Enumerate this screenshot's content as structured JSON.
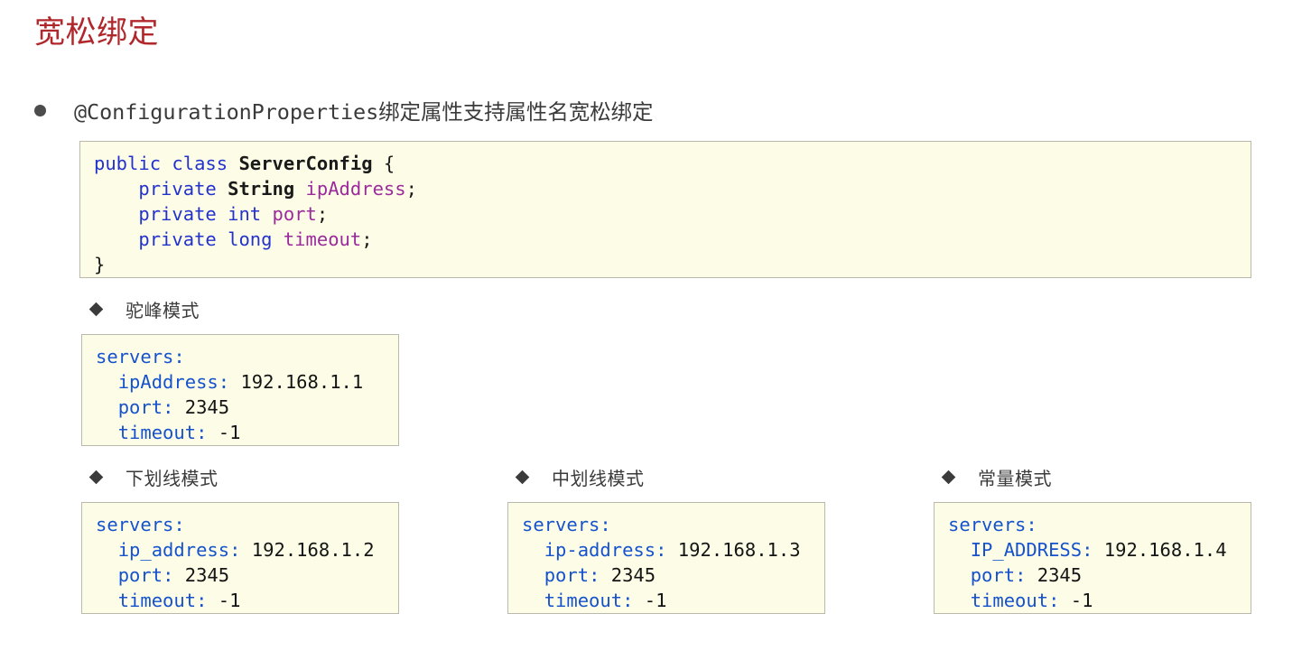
{
  "slide": {
    "title": "宽松绑定",
    "title_color": "#b1282c",
    "background_color": "#ffffff"
  },
  "bullet": {
    "marker": "round-bullet",
    "text": "@ConfigurationProperties绑定属性支持属性名宽松绑定"
  },
  "code_java": {
    "language": "java",
    "background_color": "#fdfde7",
    "border_color": "#b9b9ad",
    "lines": [
      {
        "tokens": [
          {
            "t": "public",
            "c": "kw"
          },
          {
            "t": " ",
            "c": "pun"
          },
          {
            "t": "class",
            "c": "kw"
          },
          {
            "t": " ",
            "c": "pun"
          },
          {
            "t": "ServerConfig",
            "c": "typ"
          },
          {
            "t": " {",
            "c": "pun"
          }
        ]
      },
      {
        "tokens": [
          {
            "t": "    ",
            "c": "pun"
          },
          {
            "t": "private",
            "c": "kw"
          },
          {
            "t": " ",
            "c": "pun"
          },
          {
            "t": "String",
            "c": "typ"
          },
          {
            "t": " ",
            "c": "pun"
          },
          {
            "t": "ipAddress",
            "c": "fld"
          },
          {
            "t": ";",
            "c": "pun"
          }
        ]
      },
      {
        "tokens": [
          {
            "t": "    ",
            "c": "pun"
          },
          {
            "t": "private",
            "c": "kw"
          },
          {
            "t": " ",
            "c": "pun"
          },
          {
            "t": "int",
            "c": "kw"
          },
          {
            "t": " ",
            "c": "pun"
          },
          {
            "t": "port",
            "c": "fld"
          },
          {
            "t": ";",
            "c": "pun"
          }
        ]
      },
      {
        "tokens": [
          {
            "t": "    ",
            "c": "pun"
          },
          {
            "t": "private",
            "c": "kw"
          },
          {
            "t": " ",
            "c": "pun"
          },
          {
            "t": "long",
            "c": "kw"
          },
          {
            "t": " ",
            "c": "pun"
          },
          {
            "t": "timeout",
            "c": "fld"
          },
          {
            "t": ";",
            "c": "pun"
          }
        ]
      },
      {
        "tokens": [
          {
            "t": "}",
            "c": "pun"
          }
        ]
      }
    ]
  },
  "sections": [
    {
      "id": "camel",
      "marker": "diamond-bullet",
      "heading": "驼峰模式",
      "code": {
        "language": "yaml",
        "lines": [
          {
            "tokens": [
              {
                "t": "servers",
                "c": "key"
              },
              {
                "t": ":",
                "c": "key"
              }
            ]
          },
          {
            "tokens": [
              {
                "t": "  ",
                "c": "val"
              },
              {
                "t": "ipAddress",
                "c": "key"
              },
              {
                "t": ":",
                "c": "key"
              },
              {
                "t": " 192.168.1.1",
                "c": "val"
              }
            ]
          },
          {
            "tokens": [
              {
                "t": "  ",
                "c": "val"
              },
              {
                "t": "port",
                "c": "key"
              },
              {
                "t": ":",
                "c": "key"
              },
              {
                "t": " 2345",
                "c": "val"
              }
            ]
          },
          {
            "tokens": [
              {
                "t": "  ",
                "c": "val"
              },
              {
                "t": "timeout",
                "c": "key"
              },
              {
                "t": ":",
                "c": "key"
              },
              {
                "t": " -1",
                "c": "val"
              }
            ]
          }
        ]
      }
    },
    {
      "id": "underscore",
      "marker": "diamond-bullet",
      "heading": "下划线模式",
      "code": {
        "language": "yaml",
        "lines": [
          {
            "tokens": [
              {
                "t": "servers",
                "c": "key"
              },
              {
                "t": ":",
                "c": "key"
              }
            ]
          },
          {
            "tokens": [
              {
                "t": "  ",
                "c": "val"
              },
              {
                "t": "ip_address",
                "c": "key"
              },
              {
                "t": ":",
                "c": "key"
              },
              {
                "t": " 192.168.1.2",
                "c": "val"
              }
            ]
          },
          {
            "tokens": [
              {
                "t": "  ",
                "c": "val"
              },
              {
                "t": "port",
                "c": "key"
              },
              {
                "t": ":",
                "c": "key"
              },
              {
                "t": " 2345",
                "c": "val"
              }
            ]
          },
          {
            "tokens": [
              {
                "t": "  ",
                "c": "val"
              },
              {
                "t": "timeout",
                "c": "key"
              },
              {
                "t": ":",
                "c": "key"
              },
              {
                "t": " -1",
                "c": "val"
              }
            ]
          }
        ]
      }
    },
    {
      "id": "hyphen",
      "marker": "diamond-bullet",
      "heading": "中划线模式",
      "code": {
        "language": "yaml",
        "lines": [
          {
            "tokens": [
              {
                "t": "servers",
                "c": "key"
              },
              {
                "t": ":",
                "c": "key"
              }
            ]
          },
          {
            "tokens": [
              {
                "t": "  ",
                "c": "val"
              },
              {
                "t": "ip-address",
                "c": "key"
              },
              {
                "t": ":",
                "c": "key"
              },
              {
                "t": " 192.168.1.3",
                "c": "val"
              }
            ]
          },
          {
            "tokens": [
              {
                "t": "  ",
                "c": "val"
              },
              {
                "t": "port",
                "c": "key"
              },
              {
                "t": ":",
                "c": "key"
              },
              {
                "t": " 2345",
                "c": "val"
              }
            ]
          },
          {
            "tokens": [
              {
                "t": "  ",
                "c": "val"
              },
              {
                "t": "timeout",
                "c": "key"
              },
              {
                "t": ":",
                "c": "key"
              },
              {
                "t": " -1",
                "c": "val"
              }
            ]
          }
        ]
      }
    },
    {
      "id": "constant",
      "marker": "diamond-bullet",
      "heading": "常量模式",
      "code": {
        "language": "yaml",
        "lines": [
          {
            "tokens": [
              {
                "t": "servers",
                "c": "key"
              },
              {
                "t": ":",
                "c": "key"
              }
            ]
          },
          {
            "tokens": [
              {
                "t": "  ",
                "c": "val"
              },
              {
                "t": "IP_ADDRESS",
                "c": "key"
              },
              {
                "t": ":",
                "c": "key"
              },
              {
                "t": " 192.168.1.4",
                "c": "val"
              }
            ]
          },
          {
            "tokens": [
              {
                "t": "  ",
                "c": "val"
              },
              {
                "t": "port",
                "c": "key"
              },
              {
                "t": ":",
                "c": "key"
              },
              {
                "t": " 2345",
                "c": "val"
              }
            ]
          },
          {
            "tokens": [
              {
                "t": "  ",
                "c": "val"
              },
              {
                "t": "timeout",
                "c": "key"
              },
              {
                "t": ":",
                "c": "key"
              },
              {
                "t": " -1",
                "c": "val"
              }
            ]
          }
        ]
      }
    }
  ]
}
